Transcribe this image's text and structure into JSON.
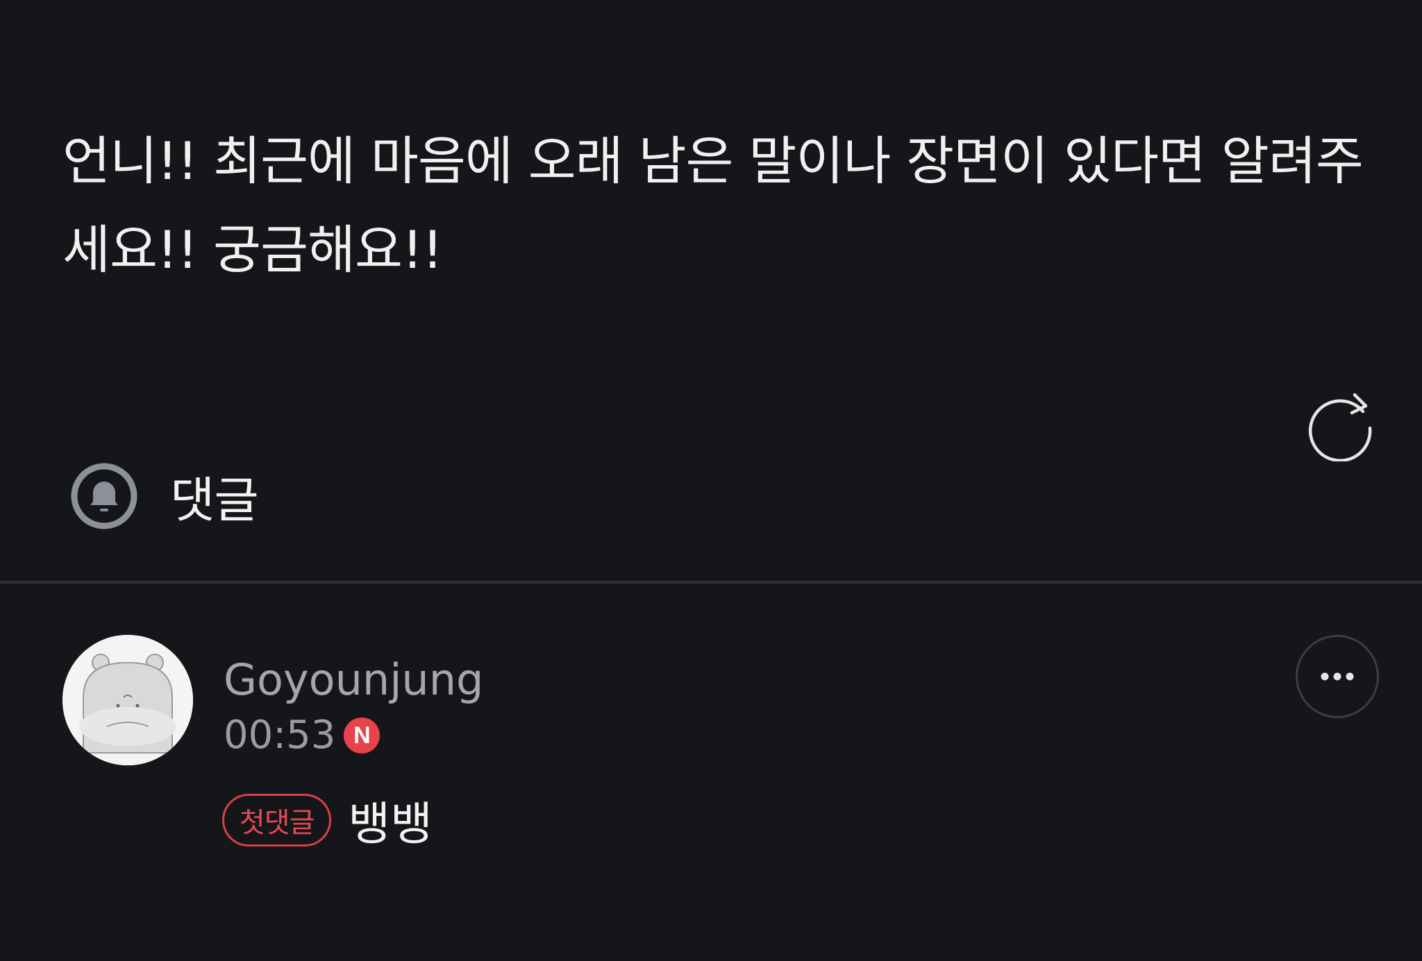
{
  "post": {
    "body": "언니!! 최근에 마음에 오래 남은 말이나 장면이 있다면 알려주세요!! 궁금해요!!"
  },
  "comments_section": {
    "title": "댓글",
    "bell_icon": "bell-icon",
    "refresh_icon": "refresh-icon"
  },
  "comment": {
    "author": "Goyounjung",
    "time": "00:53",
    "new_badge": "N",
    "first_comment_label": "첫댓글",
    "text": "뱅뱅",
    "more_icon": "more-horizontal-icon"
  },
  "colors": {
    "background": "#151619",
    "accent_red": "#e8434b",
    "divider": "#2e3034",
    "muted_text": "#a4a6aa"
  }
}
